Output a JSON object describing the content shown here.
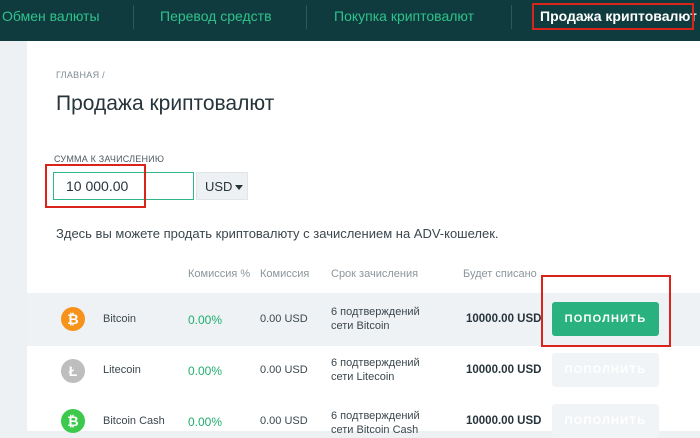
{
  "nav": {
    "items": [
      {
        "label": "Обмен валюты"
      },
      {
        "label": "Перевод средств"
      },
      {
        "label": "Покупка криптовалют"
      },
      {
        "label": "Продажа криптовалют"
      }
    ]
  },
  "breadcrumb": "ГЛАВНАЯ /",
  "page_title": "Продажа криптовалют",
  "amount": {
    "label": "СУММА К ЗАЧИСЛЕНИЮ",
    "value": "10 000.00",
    "currency": "USD"
  },
  "description": "Здесь вы можете продать криптовалюту с зачислением на ADV-кошелек.",
  "table": {
    "headers": [
      "Комиссия %",
      "Комиссия",
      "Срок зачисления",
      "Будет списано"
    ],
    "rows": [
      {
        "coin": "Bitcoin",
        "symbol": "₿",
        "color": "#f7931a",
        "fee_pct": "0.00%",
        "fee": "0.00 USD",
        "term": "6 подтверждений сети Bitcoin",
        "debit": "10000.00 USD",
        "button": "ПОПОЛНИТЬ",
        "active": true
      },
      {
        "coin": "Litecoin",
        "symbol": "Ł",
        "color": "#bebebe",
        "fee_pct": "0.00%",
        "fee": "0.00 USD",
        "term": "6 подтверждений сети Litecoin",
        "debit": "10000.00 USD",
        "button": "ПОПОЛНИТЬ",
        "active": false
      },
      {
        "coin": "Bitcoin Cash",
        "symbol": "₿",
        "color": "#3cc94c",
        "fee_pct": "0.00%",
        "fee": "0.00 USD",
        "term": "6 подтверждений сети Bitcoin Cash",
        "debit": "10000.00 USD",
        "button": "ПОПОЛНИТЬ",
        "active": false
      }
    ]
  },
  "colors": {
    "nav_bg": "#0f3b3f",
    "accent": "#29b280",
    "highlight": "#d9231b"
  }
}
